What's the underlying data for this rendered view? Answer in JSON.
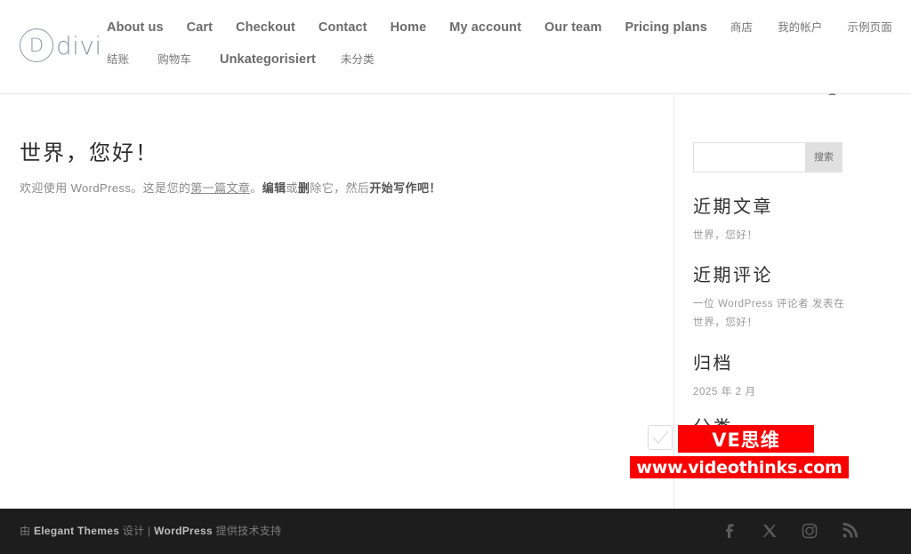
{
  "header": {
    "logo": {
      "mark": "D",
      "text": "divi"
    },
    "search_icon": "search-icon",
    "nav_row1": [
      {
        "label": "About us",
        "cjk": false
      },
      {
        "label": "Cart",
        "cjk": false
      },
      {
        "label": "Checkout",
        "cjk": false
      },
      {
        "label": "Contact",
        "cjk": false
      },
      {
        "label": "Home",
        "cjk": false
      },
      {
        "label": "My account",
        "cjk": false
      },
      {
        "label": "Our team",
        "cjk": false
      },
      {
        "label": "Pricing plans",
        "cjk": false
      },
      {
        "label": "商店",
        "cjk": true
      },
      {
        "label": "我的帐户",
        "cjk": true
      },
      {
        "label": "示例页面",
        "cjk": true
      }
    ],
    "nav_row2": [
      {
        "label": "结账",
        "cjk": true
      },
      {
        "label": "购物车",
        "cjk": true
      },
      {
        "label": "Unkategorisiert",
        "cjk": false
      },
      {
        "label": "未分类",
        "cjk": true
      }
    ]
  },
  "post": {
    "title": "世界，您好！",
    "excerpt_parts": [
      {
        "text": "欢迎使用 WordPress。这是您的",
        "style": "plain"
      },
      {
        "text": "第一篇文章",
        "style": "plain"
      },
      {
        "text": "。",
        "style": "plain"
      },
      {
        "text": "编辑",
        "style": "bold"
      },
      {
        "text": "或",
        "style": "plain"
      },
      {
        "text": "删",
        "style": "bold"
      },
      {
        "text": "除它，然后",
        "style": "plain"
      },
      {
        "text": "开始写作吧！",
        "style": "bold"
      }
    ],
    "excerpt_full": "欢迎使用 WordPress。这是您的第一篇文章。编辑或删除它，然后开始写作吧！"
  },
  "sidebar": {
    "search": {
      "value": "",
      "placeholder": "",
      "button_label": "搜索"
    },
    "widgets": [
      {
        "title": "近期文章",
        "items": [
          "世界，您好！"
        ]
      },
      {
        "title": "近期评论",
        "items": [
          "一位 WordPress 评论者 发表在",
          "世界，您好！"
        ]
      },
      {
        "title": "归档",
        "items": [
          "2025 年 2 月"
        ]
      },
      {
        "title": "分类",
        "items": []
      }
    ]
  },
  "watermark": {
    "badge": "VE思维",
    "url": "www.videothinks.com",
    "badge_color": "#fc0000",
    "text_color": "#ffffff"
  },
  "footer": {
    "credit_prefix": "由 ",
    "credit_brand1": "Elegant Themes",
    "credit_mid": " 设计 | ",
    "credit_brand2": "WordPress",
    "credit_suffix": " 提供技术支持",
    "social": [
      {
        "name": "facebook-icon"
      },
      {
        "name": "x-twitter-icon"
      },
      {
        "name": "instagram-icon"
      },
      {
        "name": "rss-icon"
      }
    ]
  }
}
